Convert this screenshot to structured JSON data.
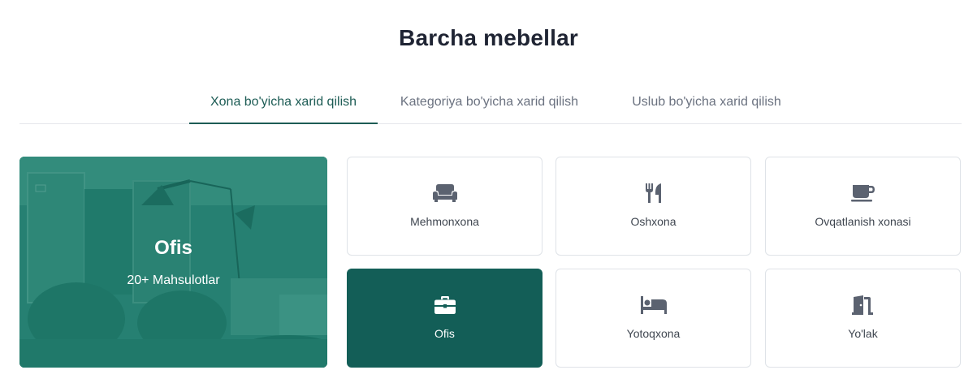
{
  "page": {
    "title": "Barcha mebellar"
  },
  "tabs": [
    {
      "label": "Xona bo'yicha xarid qilish",
      "active": true
    },
    {
      "label": "Kategoriya bo'yicha xarid qilish",
      "active": false
    },
    {
      "label": "Uslub bo'yicha xarid qilish",
      "active": false
    }
  ],
  "hero": {
    "title": "Ofis",
    "subtitle": "20+ Mahsulotlar"
  },
  "rooms": [
    {
      "label": "Mehmonxona",
      "icon": "couch-icon",
      "selected": false
    },
    {
      "label": "Oshxona",
      "icon": "utensils-icon",
      "selected": false
    },
    {
      "label": "Ovqatlanish xonasi",
      "icon": "mug-icon",
      "selected": false
    },
    {
      "label": "Ofis",
      "icon": "briefcase-icon",
      "selected": true
    },
    {
      "label": "Yotoqxona",
      "icon": "bed-icon",
      "selected": false
    },
    {
      "label": "Yo'lak",
      "icon": "door-open-icon",
      "selected": false
    }
  ],
  "colors": {
    "accent": "#1d5c55",
    "selected_card": "#135e57",
    "icon": "#5b6270"
  }
}
